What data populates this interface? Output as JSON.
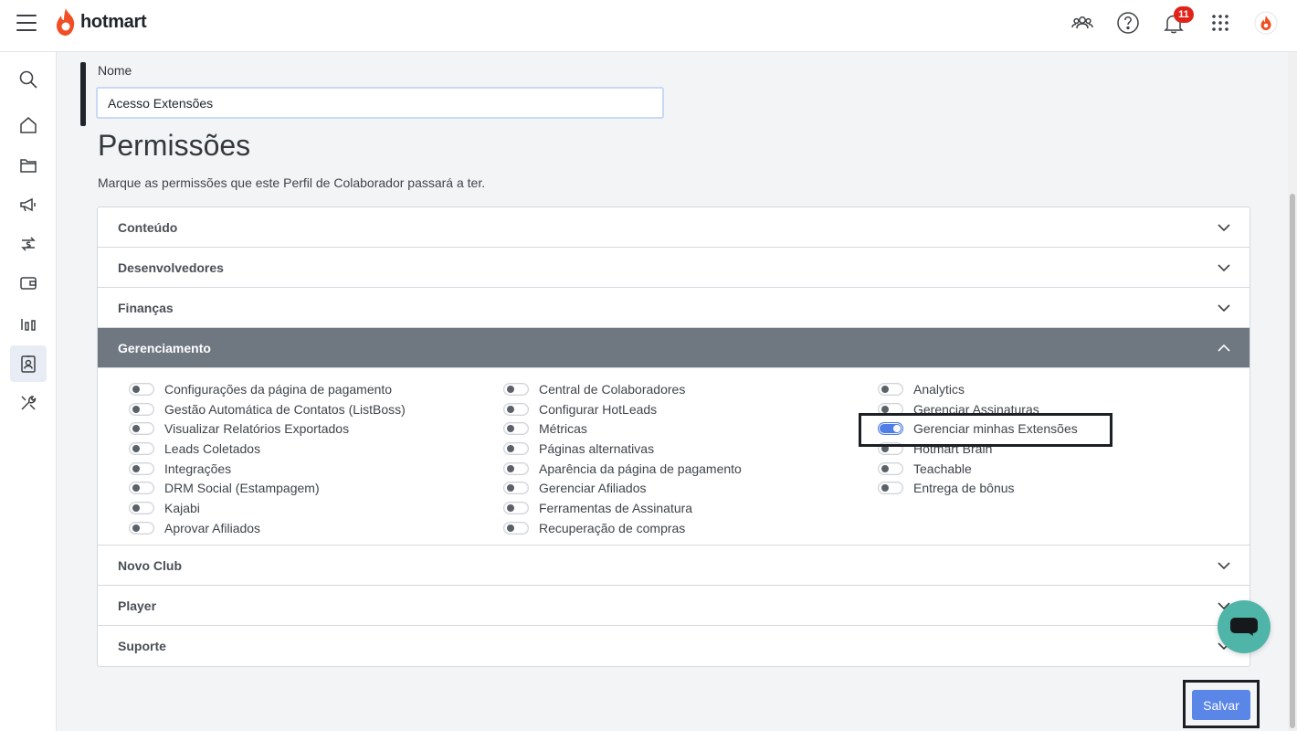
{
  "brand": {
    "name": "hotmart",
    "accent": "#f04e23"
  },
  "topbar": {
    "icons": [
      "users-icon",
      "help-icon",
      "bell-icon",
      "apps-grid-icon",
      "profile-avatar-icon"
    ],
    "notifications_count": "11"
  },
  "sidebar": {
    "items": [
      "search-icon",
      "home-icon",
      "folder-icon",
      "megaphone-icon",
      "money-transfer-icon",
      "wallet-icon",
      "analytics-icon",
      "collaborator-badge-icon",
      "tools-icon"
    ],
    "active": "collaborator-badge-icon"
  },
  "form": {
    "name_label": "Nome",
    "name_value": "Acesso Extensões"
  },
  "permissions": {
    "title": "Permissões",
    "description": "Marque as permissões que este Perfil de Colaborador passará a ter.",
    "sections": [
      {
        "label": "Conteúdo",
        "open": false
      },
      {
        "label": "Desenvolvedores",
        "open": false
      },
      {
        "label": "Finanças",
        "open": false
      },
      {
        "label": "Gerenciamento",
        "open": true
      },
      {
        "label": "Novo Club",
        "open": false
      },
      {
        "label": "Player",
        "open": false
      },
      {
        "label": "Suporte",
        "open": false
      }
    ],
    "gerenciamento_columns": [
      [
        {
          "label": "Configurações da página de pagamento",
          "on": false
        },
        {
          "label": "Gestão Automática de Contatos (ListBoss)",
          "on": false
        },
        {
          "label": "Visualizar Relatórios Exportados",
          "on": false
        },
        {
          "label": "Leads Coletados",
          "on": false
        },
        {
          "label": "Integrações",
          "on": false
        },
        {
          "label": "DRM Social (Estampagem)",
          "on": false
        },
        {
          "label": "Kajabi",
          "on": false
        },
        {
          "label": "Aprovar Afiliados",
          "on": false
        }
      ],
      [
        {
          "label": "Central de Colaboradores",
          "on": false
        },
        {
          "label": "Configurar HotLeads",
          "on": false
        },
        {
          "label": "Métricas",
          "on": false
        },
        {
          "label": "Páginas alternativas",
          "on": false
        },
        {
          "label": "Aparência da página de pagamento",
          "on": false
        },
        {
          "label": "Gerenciar Afiliados",
          "on": false
        },
        {
          "label": "Ferramentas de Assinatura",
          "on": false
        },
        {
          "label": "Recuperação de compras",
          "on": false
        }
      ],
      [
        {
          "label": "Analytics",
          "on": false
        },
        {
          "label": "Gerenciar Assinaturas",
          "on": false
        },
        {
          "label": "Gerenciar minhas Extensões",
          "on": true
        },
        {
          "label": "Hotmart Brain",
          "on": false
        },
        {
          "label": "Teachable",
          "on": false
        },
        {
          "label": "Entrega de bônus",
          "on": false
        }
      ]
    ]
  },
  "actions": {
    "save_label": "Salvar"
  },
  "colors": {
    "toggle_on": "#4f7fe6",
    "section_open_bg": "#6f7781",
    "save_button": "#5a86e8",
    "chat_button": "#4fb5a8",
    "badge": "#e0241a"
  }
}
